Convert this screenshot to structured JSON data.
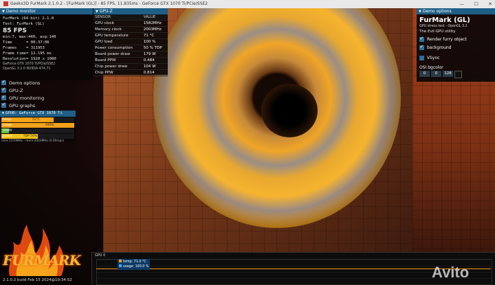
{
  "window": {
    "title": "Geeks3D FurMark 2.1.0.2 - [FurMark (GL)] - 85 FPS, 11.835ms - GeForce GTX 1070 Ti/PCIe/SSE2",
    "min": "—",
    "max": "☐",
    "close": "✕"
  },
  "demo_monitor": {
    "header": "Demo monitor",
    "app": "FurMark (64-bit) 2.1.0",
    "test": "Test: FurMark (GL)",
    "fps": "85 FPS",
    "minmax": "min:7, max:440, avg:140",
    "rows": [
      {
        "k": "Time",
        "v": "= 00:37:06"
      },
      {
        "k": "Frames",
        "v": "= 311953"
      },
      {
        "k": "Frame time",
        "v": "= 12.195 ms"
      },
      {
        "k": "Resolution",
        "v": "= 1920 x 1080"
      }
    ],
    "gpu_name": "GeForce GTX 1070 Ti/PCIe/SSE2",
    "opengl": "OpenGL 3.2.0 NVIDIA 474.71"
  },
  "checks": [
    {
      "label": "Demo options",
      "checked": true
    },
    {
      "label": "GPU-Z",
      "checked": true
    },
    {
      "label": "GPU monitoring",
      "checked": true
    },
    {
      "label": "GPU graphs",
      "checked": true
    }
  ],
  "gpu_monitor": {
    "header": "GPU0: GeForce GTX 1070 Ti",
    "bars": [
      {
        "label": "temp",
        "value": "71°C",
        "fill": 0.72,
        "color": "#f3a21a"
      },
      {
        "label": "usage",
        "value": "100%",
        "fill": 1.0,
        "color": "#f3a21a"
      },
      {
        "label": "VRAM",
        "value": "10% (780 MB)",
        "fill": 0.1,
        "color": "#5fc13a"
      },
      {
        "label": "power",
        "value": "TDP 50% PPW 0.814",
        "fill": 0.5,
        "color": "#f3c21a"
      }
    ],
    "footer": "core:1570MHz - mem:2003MHz (0.00mps)"
  },
  "gpuz": {
    "header": "GPU-Z",
    "col_sensor": "SENSOR",
    "col_value": "VALUE",
    "rows": [
      {
        "s": "GPU clock",
        "v": "1582MHz"
      },
      {
        "s": "Memory clock",
        "v": "2003MHz"
      },
      {
        "s": "GPU temperature",
        "v": "71 °C"
      },
      {
        "s": "GPU load",
        "v": "100 %"
      },
      {
        "s": "Power consumption",
        "v": "50 % TDP"
      },
      {
        "s": "Board power draw",
        "v": "179 W"
      },
      {
        "s": "Board PPW",
        "v": "0.484"
      },
      {
        "s": "Chip power draw",
        "v": "104 W"
      },
      {
        "s": "Chip PPW",
        "v": "0.814"
      }
    ]
  },
  "demo_options": {
    "header": "Demo options",
    "title": "FurMark (GL)",
    "sub": "GPU stress test - OpenGL 3.2",
    "sub2": "The Evil GPU utility",
    "render_furry": "Render furry object",
    "background": "background",
    "vsync": "VSync",
    "osi_bgcolor": "OSI bgcolor",
    "osi_values": [
      "0",
      "0",
      "128"
    ]
  },
  "graph": {
    "label": "GPU 0",
    "legend_temp": "temp: 71.0 °C",
    "legend_usage": "usage: 100.0 %"
  },
  "logo": {
    "text": "FURMARK"
  },
  "build": "2.1.0.2 build Feb 15 2024@19:34:52",
  "watermark": "Avito"
}
